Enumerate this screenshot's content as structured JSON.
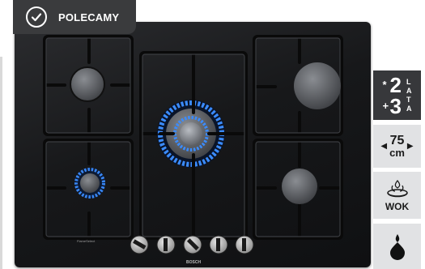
{
  "badge": {
    "label": "POLECAMY",
    "icon": "checkmark-circle-icon"
  },
  "hob": {
    "brand": "BOSCH",
    "series": "FlameSelect"
  },
  "features": {
    "warranty": {
      "prefix1": "*",
      "years1": "2",
      "prefix2": "+",
      "years2": "3",
      "unit_letters": [
        "L",
        "A",
        "T",
        "A"
      ]
    },
    "width": {
      "value": "75",
      "unit": "cm",
      "left_arrow": "◀",
      "right_arrow": "▶"
    },
    "wok": {
      "label": "WOK",
      "icon": "wok-burner-icon"
    },
    "flame": {
      "icon": "flame-drop-icon"
    }
  },
  "colors": {
    "badge_bg": "#3a3b3d",
    "tile_bg": "#e1e2e4",
    "warranty_bg": "#37383b",
    "flame_blue": "#3b8cff",
    "glass": "#17181a"
  }
}
